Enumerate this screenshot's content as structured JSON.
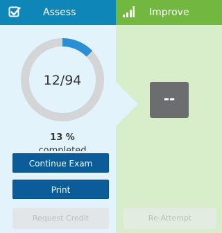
{
  "tabs": {
    "assess": {
      "label": "Assess",
      "icon": "checkbox-check-icon",
      "color": "#0f86b8"
    },
    "improve": {
      "label": "Improve",
      "icon": "signal-bars-icon",
      "color": "#72b840"
    }
  },
  "assess": {
    "progress_text": "12/94",
    "progress_fraction": 0.128,
    "percent_text": "13 %",
    "cut_text": "completed",
    "buttons": {
      "continue_label": "Continue Exam",
      "print_label": "Print",
      "request_credit_label": "Request Credit"
    }
  },
  "improve": {
    "score_text": "--",
    "reattempt_label": "Re-Attempt"
  },
  "colors": {
    "assess_bg": "#e2f3fb",
    "improve_bg": "#d8eecb",
    "primary_button": "#0b5c99",
    "ring_track": "#d3d5d7",
    "ring_fill": "#2b8fd6",
    "score_box": "#6b6d6e"
  }
}
